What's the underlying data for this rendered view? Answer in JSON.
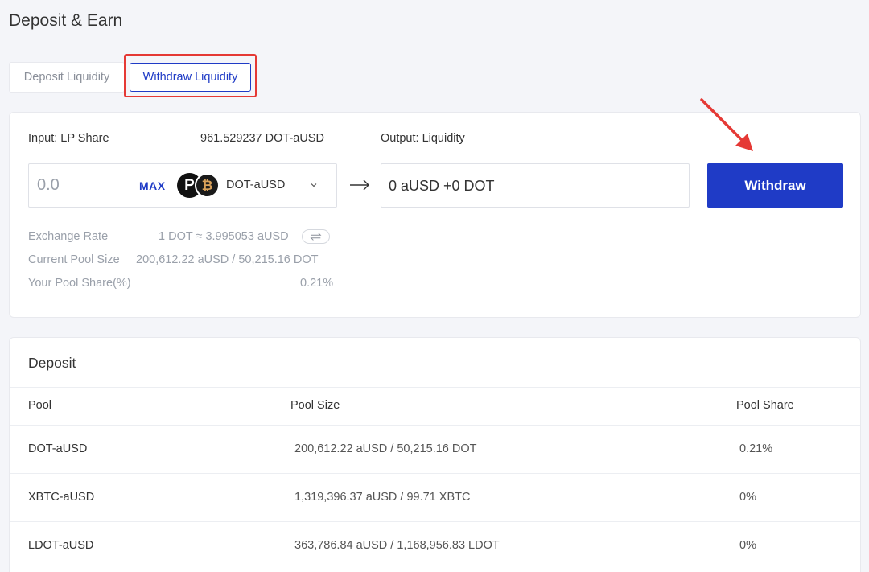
{
  "page": {
    "title": "Deposit & Earn"
  },
  "tabs": {
    "deposit": "Deposit Liquidity",
    "withdraw": "Withdraw Liquidity"
  },
  "withdraw_panel": {
    "input_label": "Input: LP Share",
    "lp_balance": "961.529237 DOT-aUSD",
    "output_label": "Output: Liquidity",
    "amount_placeholder": "0.0",
    "max_label": "MAX",
    "token_pair": "DOT-aUSD",
    "output_value": "0 aUSD +0 DOT",
    "withdraw_button": "Withdraw",
    "info": {
      "exchange_rate_label": "Exchange Rate",
      "exchange_rate_value": "1 DOT ≈ 3.995053 aUSD",
      "pool_size_label": "Current Pool Size",
      "pool_size_value": "200,612.22 aUSD / 50,215.16 DOT",
      "pool_share_label": "Your Pool Share(%)",
      "pool_share_value": "0.21%"
    }
  },
  "deposit_table": {
    "title": "Deposit",
    "headers": {
      "pool": "Pool",
      "pool_size": "Pool Size",
      "pool_share": "Pool Share"
    },
    "rows": [
      {
        "pool": "DOT-aUSD",
        "size": "200,612.22 aUSD / 50,215.16 DOT",
        "share": "0.21%"
      },
      {
        "pool": "XBTC-aUSD",
        "size": "1,319,396.37 aUSD / 99.71 XBTC",
        "share": "0%"
      },
      {
        "pool": "LDOT-aUSD",
        "size": "363,786.84 aUSD / 1,168,956.83 LDOT",
        "share": "0%"
      }
    ]
  },
  "colors": {
    "accent": "#1f3bc6",
    "highlight": "#e53935",
    "background": "#f4f5f9",
    "muted_text": "#9aa0aa"
  },
  "icons": {
    "dot_token": "polkadot-icon",
    "ausd_token": "ausd-icon",
    "dropdown": "chevron-down-icon",
    "arrow": "arrow-right-icon",
    "swap": "swap-icon",
    "annotation": "red-arrow-icon"
  }
}
